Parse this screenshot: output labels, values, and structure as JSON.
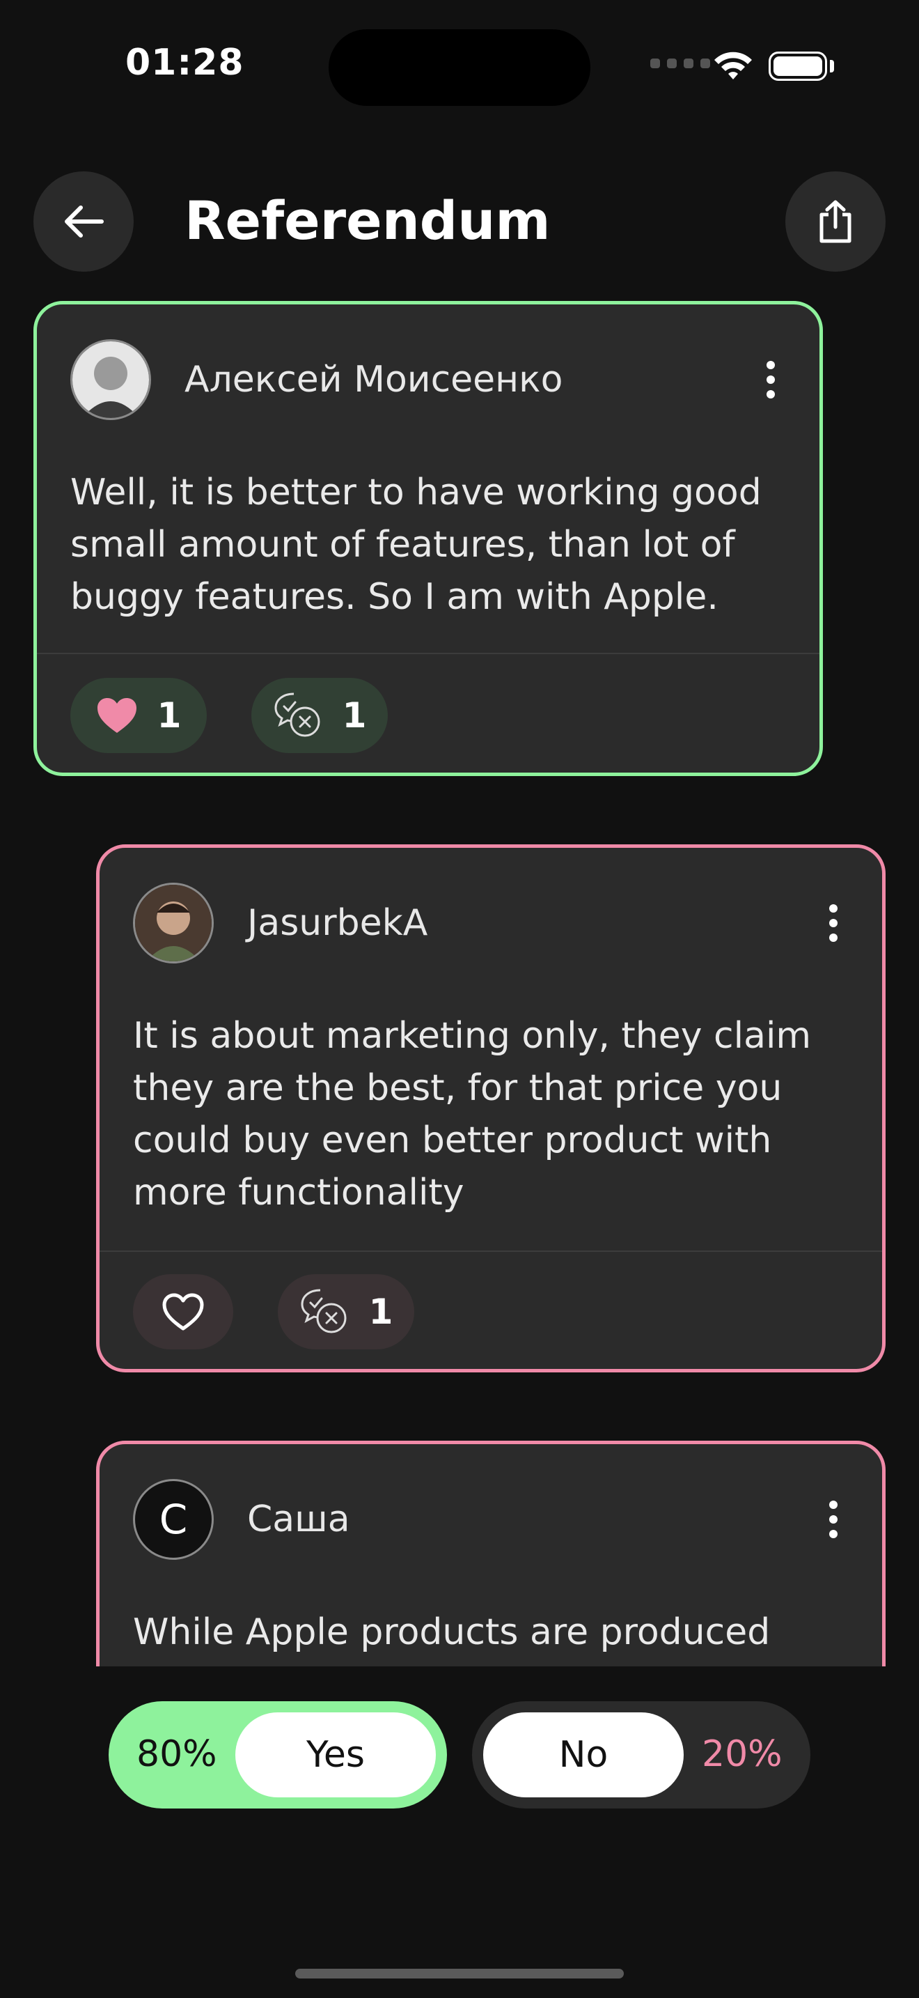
{
  "status": {
    "time": "01:28"
  },
  "header": {
    "title": "Referendum",
    "back_icon": "arrow-left-icon",
    "share_icon": "share-icon"
  },
  "colors": {
    "yes": "#8ef29c",
    "no": "#f08aa8",
    "background": "#111111",
    "card": "#2b2b2b"
  },
  "comments": [
    {
      "author": "Алексей Моисеенко",
      "text": "Well, it is better to have working good small amount of features, than lot of buggy features. So I am with Apple.",
      "likes": "1",
      "liked": true,
      "replies": "1",
      "side": "yes"
    },
    {
      "author": "JasurbekA",
      "text": "It is about marketing only, they claim they are the best, for that price you could buy even better product with more functionality",
      "likes": "",
      "liked": false,
      "replies": "1",
      "side": "no"
    },
    {
      "author": "Саша",
      "avatar_letter": "C",
      "text": "While Apple products are produced with",
      "side": "no"
    }
  ],
  "vote": {
    "yes_percent": "80%",
    "yes_label": "Yes",
    "no_label": "No",
    "no_percent": "20%"
  }
}
